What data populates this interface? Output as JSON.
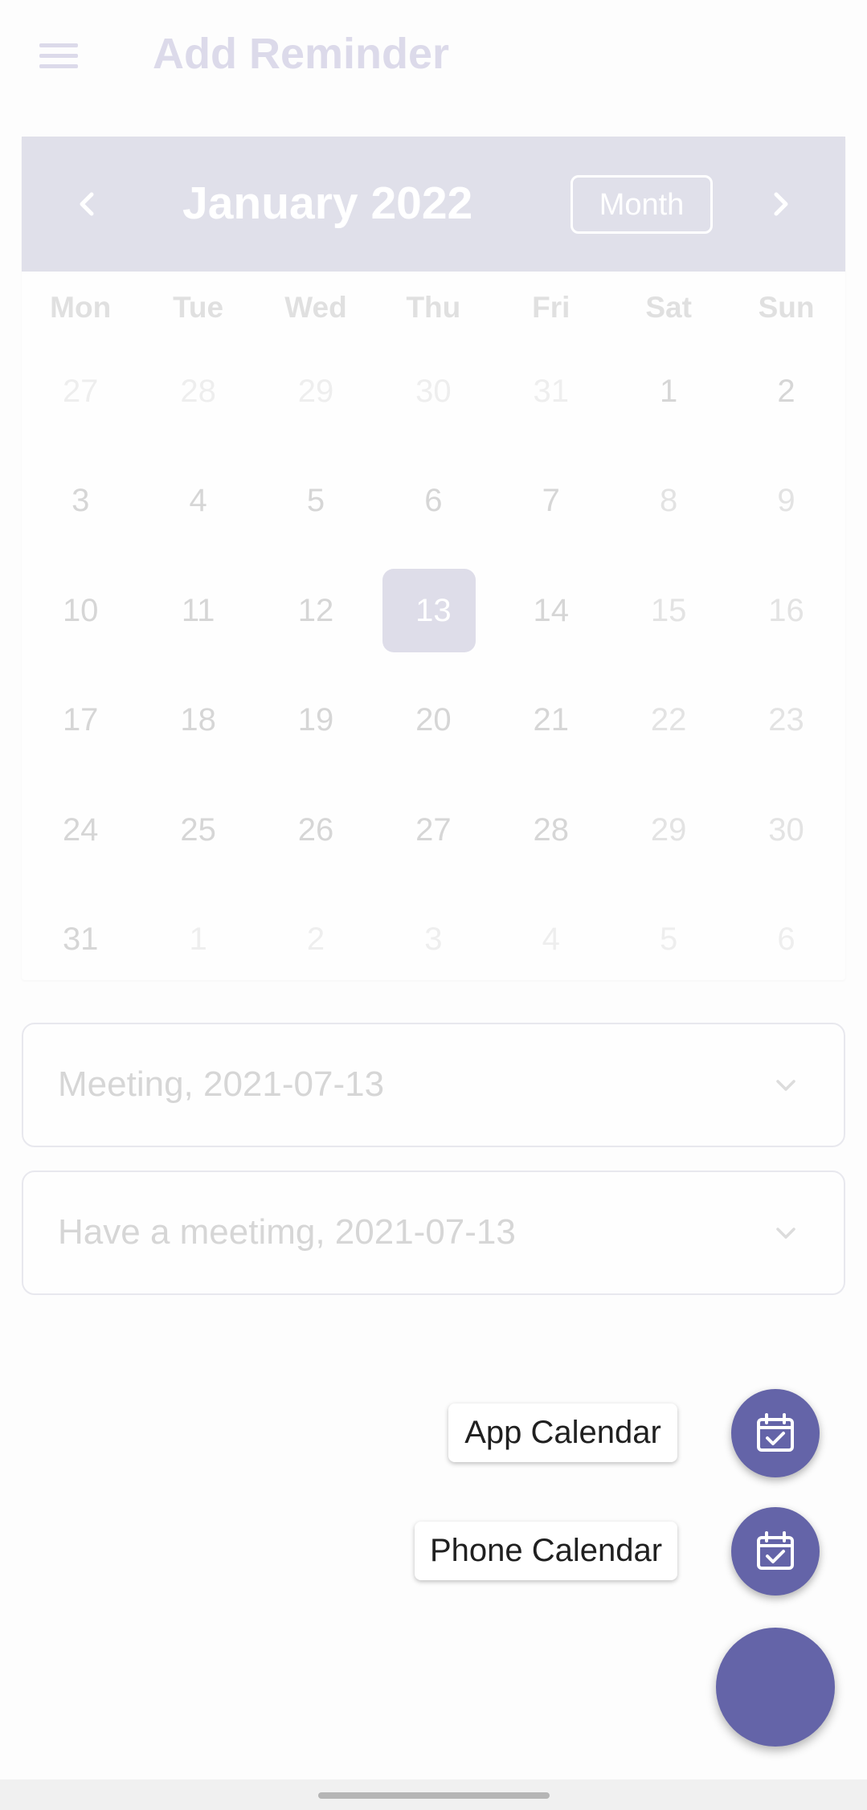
{
  "app_bar": {
    "title": "Add Reminder",
    "menu_icon": "hamburger-menu-icon"
  },
  "calendar": {
    "month_title": "January 2022",
    "view_toggle": "Month",
    "prev_icon": "chevron-left-icon",
    "next_icon": "chevron-right-icon",
    "header_color": "#e0e0ea",
    "weekdays": [
      "Mon",
      "Tue",
      "Wed",
      "Thu",
      "Fri",
      "Sat",
      "Sun"
    ],
    "selected_day": "13",
    "weeks": [
      [
        "27",
        "28",
        "29",
        "30",
        "31",
        "1",
        "2"
      ],
      [
        "3",
        "4",
        "5",
        "6",
        "7",
        "8",
        "9"
      ],
      [
        "10",
        "11",
        "12",
        "13",
        "14",
        "15",
        "16"
      ],
      [
        "17",
        "18",
        "19",
        "20",
        "21",
        "22",
        "23"
      ],
      [
        "24",
        "25",
        "26",
        "27",
        "28",
        "29",
        "30"
      ],
      [
        "31",
        "1",
        "2",
        "3",
        "4",
        "5",
        "6"
      ]
    ]
  },
  "dropdowns": [
    {
      "value": "Meeting, 2021-07-13",
      "icon": "chevron-down-icon"
    },
    {
      "value": "Have a meetimg, 2021-07-13",
      "icon": "chevron-down-icon"
    }
  ],
  "fab_menu": {
    "items": [
      {
        "label": "App Calendar",
        "icon": "calendar-check-icon"
      },
      {
        "label": "Phone Calendar",
        "icon": "calendar-check-icon"
      }
    ],
    "accent_color": "#6464a8"
  }
}
